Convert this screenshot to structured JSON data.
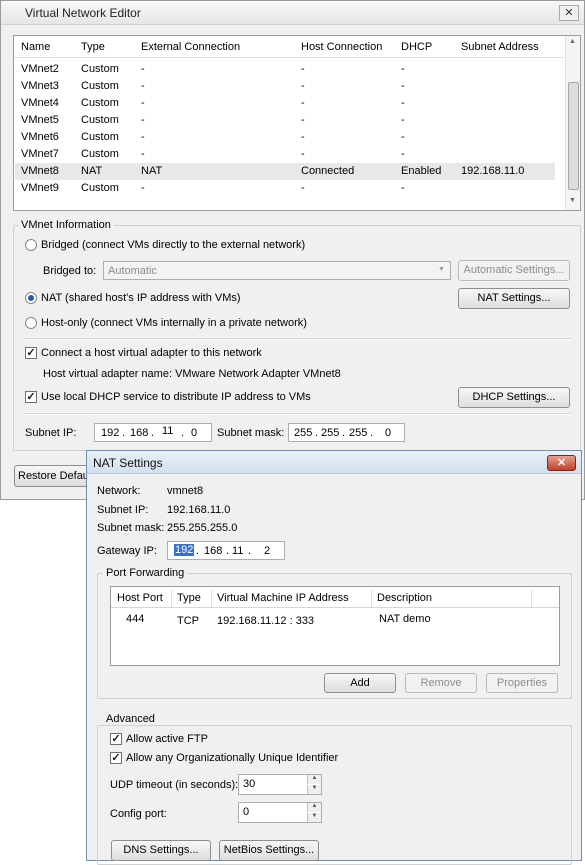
{
  "vne": {
    "title": "Virtual Network Editor",
    "close_glyph": "✕",
    "columns": [
      "Name",
      "Type",
      "External Connection",
      "Host Connection",
      "DHCP",
      "Subnet Address"
    ],
    "rows": [
      [
        "VMnet2",
        "Custom",
        "-",
        "-",
        "-",
        ""
      ],
      [
        "VMnet3",
        "Custom",
        "-",
        "-",
        "-",
        ""
      ],
      [
        "VMnet4",
        "Custom",
        "-",
        "-",
        "-",
        ""
      ],
      [
        "VMnet5",
        "Custom",
        "-",
        "-",
        "-",
        ""
      ],
      [
        "VMnet6",
        "Custom",
        "-",
        "-",
        "-",
        ""
      ],
      [
        "VMnet7",
        "Custom",
        "-",
        "-",
        "-",
        ""
      ],
      [
        "VMnet8",
        "NAT",
        "NAT",
        "Connected",
        "Enabled",
        "192.168.11.0"
      ],
      [
        "VMnet9",
        "Custom",
        "-",
        "-",
        "-",
        ""
      ]
    ],
    "info": {
      "group_label": "VMnet Information",
      "bridged_label": "Bridged (connect VMs directly to the external network)",
      "bridged_to_label": "Bridged to:",
      "bridged_to_value": "Automatic",
      "auto_settings_button": "Automatic Settings...",
      "nat_label": "NAT (shared host's IP address with VMs)",
      "nat_settings_button": "NAT Settings...",
      "hostonly_label": "Host-only (connect VMs internally in a private network)",
      "connect_adapter_label": "Connect a host virtual adapter to this network",
      "adapter_name_text": "Host virtual adapter name: VMware Network Adapter VMnet8",
      "dhcp_label": "Use local DHCP service to distribute IP address to VMs",
      "dhcp_settings_button": "DHCP Settings...",
      "subnet_ip_label": "Subnet IP:",
      "subnet_ip": [
        "192",
        "168",
        "11",
        "0"
      ],
      "subnet_mask_label": "Subnet mask:",
      "subnet_mask": [
        "255",
        "255",
        "255",
        "0"
      ]
    },
    "restore_button": "Restore Defaults"
  },
  "nat": {
    "title": "NAT Settings",
    "close_glyph": "✕",
    "network_label": "Network:",
    "network_value": "vmnet8",
    "subnet_ip_label": "Subnet IP:",
    "subnet_ip_value": "192.168.11.0",
    "subnet_mask_label": "Subnet mask:",
    "subnet_mask_value": "255.255.255.0",
    "gateway_label": "Gateway IP:",
    "gateway": [
      "192",
      "168",
      "11",
      "2"
    ],
    "port_forwarding": {
      "label": "Port Forwarding",
      "columns": [
        "Host Port",
        "Type",
        "Virtual Machine IP Address",
        "Description"
      ],
      "rows": [
        {
          "host_port": "444",
          "type": "TCP",
          "vm_ip": "192.168.11.12 : 333",
          "description": "NAT demo"
        }
      ],
      "add_button": "Add",
      "remove_button": "Remove",
      "properties_button": "Properties"
    },
    "advanced": {
      "label": "Advanced",
      "allow_ftp_label": "Allow active FTP",
      "allow_oui_label": "Allow any Organizationally Unique Identifier",
      "udp_timeout_label": "UDP timeout (in seconds):",
      "udp_timeout_value": "30",
      "config_port_label": "Config port:",
      "config_port_value": "0"
    },
    "dns_button": "DNS Settings...",
    "netbios_button": "NetBios Settings...",
    "spin_up": "▲",
    "spin_down": "▼"
  },
  "colors": {
    "window_bg": "#f0f0f0",
    "selection_highlight": "#3a6fd0",
    "close_button_red": "#c0412a"
  }
}
